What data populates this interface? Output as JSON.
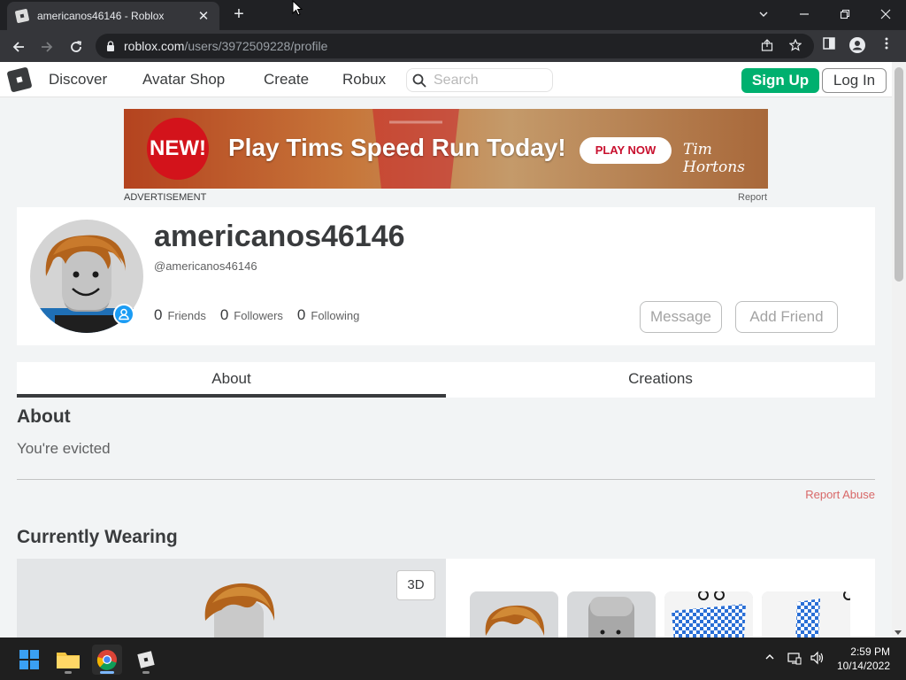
{
  "browser": {
    "tab_title": "americanos46146 - Roblox",
    "url_host": "roblox.com",
    "url_path": "/users/3972509228/profile",
    "new_tab_symbol": "+",
    "close_symbol": "✕"
  },
  "nav": {
    "links": [
      "Discover",
      "Avatar Shop",
      "Create",
      "Robux"
    ],
    "search_placeholder": "Search",
    "signup_label": "Sign Up",
    "login_label": "Log In"
  },
  "ad": {
    "badge": "NEW!",
    "headline": "Play Tims Speed Run Today!",
    "cta": "PLAY NOW",
    "brand": "Tim Hortons",
    "label": "ADVERTISEMENT",
    "report": "Report"
  },
  "profile": {
    "username": "americanos46146",
    "handle": "@americanos46146",
    "friends_count": "0",
    "friends_label": "Friends",
    "followers_count": "0",
    "followers_label": "Followers",
    "following_count": "0",
    "following_label": "Following",
    "message_label": "Message",
    "add_friend_label": "Add Friend"
  },
  "tabs": [
    "About",
    "Creations"
  ],
  "about": {
    "title": "About",
    "text": "You're evicted",
    "report_abuse": "Report Abuse"
  },
  "wearing": {
    "title": "Currently Wearing",
    "view_toggle": "3D"
  },
  "taskbar": {
    "time": "2:59 PM",
    "date": "10/14/2022"
  },
  "colors": {
    "signup_green": "#00b06f",
    "presence_blue": "#1b9cf4",
    "report_red": "#d86868",
    "ad_red": "#d3131b"
  }
}
